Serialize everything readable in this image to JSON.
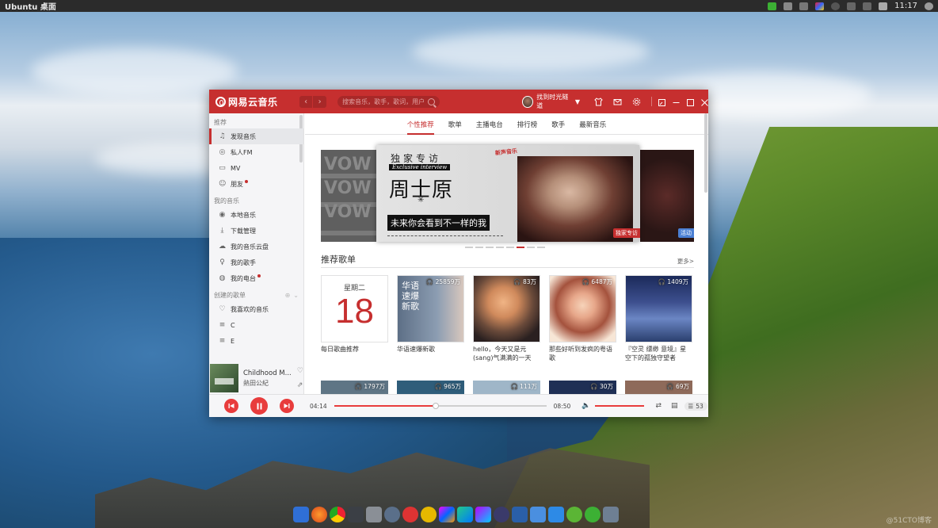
{
  "desktop": {
    "title": "Ubuntu 桌面",
    "clock": "11:17",
    "watermark": "@51CTO博客"
  },
  "app": {
    "name": "网易云音乐",
    "search_placeholder": "搜索音乐，歌手，歌词，用户",
    "username": "找到时光隧道"
  },
  "sidebar": {
    "section_recommend": "推荐",
    "recommend_items": [
      {
        "label": "发现音乐",
        "icon": "music-note-icon"
      },
      {
        "label": "私人FM",
        "icon": "radio-icon"
      },
      {
        "label": "MV",
        "icon": "video-icon"
      },
      {
        "label": "朋友",
        "icon": "friends-icon"
      }
    ],
    "section_my_music": "我的音乐",
    "my_music_items": [
      {
        "label": "本地音乐",
        "icon": "local-music-icon"
      },
      {
        "label": "下载管理",
        "icon": "download-icon"
      },
      {
        "label": "我的音乐云盘",
        "icon": "cloud-icon"
      },
      {
        "label": "我的歌手",
        "icon": "singer-icon"
      },
      {
        "label": "我的电台",
        "icon": "podcast-icon"
      }
    ],
    "section_created": "创建的歌单",
    "created_items": [
      {
        "label": "我喜欢的音乐",
        "icon": "heart-icon"
      },
      {
        "label": "C",
        "icon": "playlist-icon"
      },
      {
        "label": "E",
        "icon": "playlist-icon"
      }
    ]
  },
  "now_playing": {
    "song": "Childhood M...",
    "artist": "熱田公紀"
  },
  "tabs": [
    "个性推荐",
    "歌单",
    "主播电台",
    "排行榜",
    "歌手",
    "最新音乐"
  ],
  "active_tab": 0,
  "banner": {
    "line1": "独家专访",
    "line2": "Exclusive interview",
    "name": "周士原",
    "slogan": "未来你会看到不一样的我",
    "ribbon": "新声音乐",
    "tag_exclusive": "独家专访",
    "tag_activity": "活动",
    "dot_count": 8,
    "active_dot": 5
  },
  "playlists": {
    "title": "推荐歌单",
    "more": "更多>",
    "daily": {
      "weekday": "星期二",
      "day": "18",
      "name": "每日歌曲推荐"
    },
    "items": [
      {
        "count": "25859万",
        "name": "华语速爆新歌",
        "cover_text": "华语\n速爆\n新歌"
      },
      {
        "count": "83万",
        "name": "hello，今天又是元(sang)气满满的一天"
      },
      {
        "count": "6487万",
        "name": "那些好听到发疯的粤语歌"
      },
      {
        "count": "1409万",
        "name": "『空灵 缥缈 意境』星空下的孤独守望者"
      }
    ],
    "row2_counts": [
      "1797万",
      "965万",
      "111万",
      "30万",
      "69万"
    ]
  },
  "player": {
    "current_time": "04:14",
    "total_time": "08:50",
    "progress": 0.48,
    "volume": 1.0,
    "playlist_count": "53"
  },
  "colors": {
    "brand": "#c62f2f",
    "accent": "#e83c3c"
  }
}
